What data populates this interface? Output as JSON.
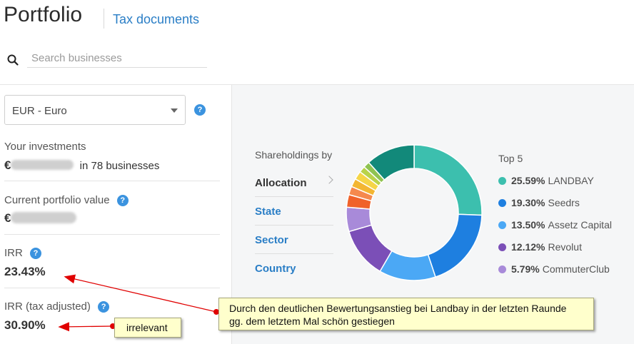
{
  "header": {
    "title": "Portfolio",
    "tax_link": "Tax documents"
  },
  "search": {
    "placeholder": "Search businesses",
    "value": ""
  },
  "currency": {
    "selected": "EUR - Euro",
    "help": "?"
  },
  "investments": {
    "label": "Your investments",
    "currency_symbol": "€",
    "suffix": "in 78 businesses"
  },
  "portfolio_value": {
    "label": "Current portfolio value",
    "currency_symbol": "€"
  },
  "irr": {
    "label": "IRR",
    "value": "23.43%"
  },
  "irr_tax": {
    "label": "IRR (tax adjusted)",
    "value": "30.90%"
  },
  "shareholdings": {
    "label": "Shareholdings by",
    "options": [
      "Allocation",
      "State",
      "Sector",
      "Country"
    ],
    "active": "Allocation"
  },
  "top5": {
    "title": "Top 5",
    "items": [
      {
        "pct": "25.59%",
        "name": "LANDBAY",
        "color": "#3cbfae"
      },
      {
        "pct": "19.30%",
        "name": "Seedrs",
        "color": "#1e7fe0"
      },
      {
        "pct": "13.50%",
        "name": "Assetz Capital",
        "color": "#4ba8f5"
      },
      {
        "pct": "12.12%",
        "name": "Revolut",
        "color": "#7b4fb7"
      },
      {
        "pct": "5.79%",
        "name": "CommuterClub",
        "color": "#a88ad9"
      }
    ]
  },
  "chart_data": {
    "type": "pie",
    "categories": [
      "LANDBAY",
      "Seedrs",
      "Assetz Capital",
      "Revolut",
      "CommuterClub",
      "",
      "",
      "",
      "",
      "",
      "",
      ""
    ],
    "values": [
      25.59,
      19.3,
      13.5,
      12.12,
      5.79,
      3.0,
      2.0,
      2.0,
      2.0,
      1.5,
      1.5,
      11.7
    ],
    "colors": [
      "#3cbfae",
      "#1e7fe0",
      "#4ba8f5",
      "#7b4fb7",
      "#a88ad9",
      "#f0622a",
      "#f5894d",
      "#f3b632",
      "#f5d547",
      "#b9d34a",
      "#8fc351",
      "#12897a"
    ]
  },
  "annotations": {
    "note_line1": "Durch den deutlichen Bewertungsanstieg bei Landbay in der letzten Raunde",
    "note_line2": "gg. dem letztem Mal schön gestiegen",
    "note_small": "irrelevant",
    "arrow_color": "#e00000"
  }
}
